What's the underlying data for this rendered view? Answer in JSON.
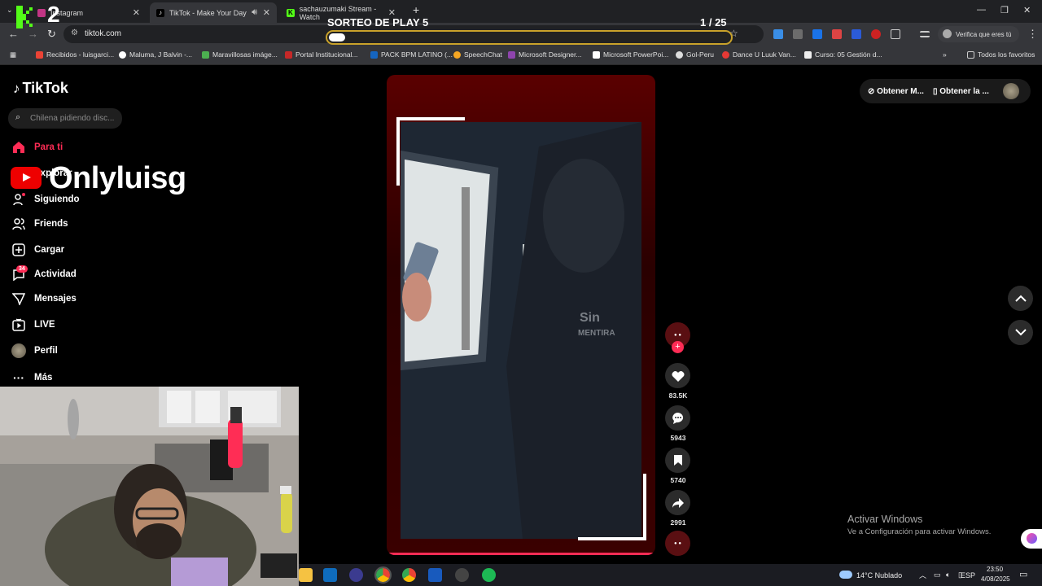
{
  "stream_overlay": {
    "channel_number": "2",
    "name": "Onlyluisg",
    "sorteo_title": "SORTEO DE PLAY 5",
    "sorteo_progress": "1   / 25",
    "sorteo_fraction": 0.04
  },
  "browser": {
    "tabs": [
      {
        "title": "Instagram",
        "active": false
      },
      {
        "title": "TikTok - Make Your Day",
        "active": true
      },
      {
        "title": "sachauzumaki Stream - Watch",
        "active": false
      }
    ],
    "url": "tiktok.com",
    "verify_label": "Verifica que eres tú",
    "bookmarks": [
      "Recibidos - luisgarci...",
      "Maluma, J Balvin -...",
      "Maravillosas imáge...",
      "Portal Institucional...",
      "PACK BPM LATINO (...",
      "SpeechChat",
      "Microsoft Designer...",
      "Microsoft PowerPoi...",
      "Gol-Peru",
      "Dance U Luuk Van...",
      "Curso: 05 Gestión d..."
    ],
    "all_bookmarks": "Todos los favoritos",
    "accent_colors": {
      "sorteo_border": "#c9a22a",
      "tiktok_red": "#fe2c55"
    }
  },
  "tiktok": {
    "logo": "TikTok",
    "search_placeholder": "Chilena pidiendo disc...",
    "nav": [
      {
        "label": "Para ti",
        "icon": "home-icon"
      },
      {
        "label": "Explorar",
        "icon": "compass-icon"
      },
      {
        "label": "Siguiendo",
        "icon": "following-icon"
      },
      {
        "label": "Friends",
        "icon": "friends-icon"
      },
      {
        "label": "Cargar",
        "icon": "upload-icon"
      },
      {
        "label": "Actividad",
        "icon": "activity-icon"
      },
      {
        "label": "Mensajes",
        "icon": "messages-icon"
      },
      {
        "label": "LIVE",
        "icon": "live-icon"
      },
      {
        "label": "Perfil",
        "icon": "profile-icon"
      },
      {
        "label": "Más",
        "icon": "more-icon"
      }
    ],
    "activity_badge": "34",
    "top_right": {
      "btn1": "Obtener M...",
      "btn2": "Obtener la ..."
    },
    "actions": {
      "likes": "83.5K",
      "comments": "5943",
      "saves": "5740",
      "shares": "2991"
    },
    "watermark": "Sin MENTIRA"
  },
  "windows": {
    "activate_title": "Activar Windows",
    "activate_sub": "Ve a Configuración para activar Windows.",
    "weather": "14°C  Nublado",
    "lang": "ESP",
    "time": "23:50",
    "date": "4/08/2025"
  }
}
